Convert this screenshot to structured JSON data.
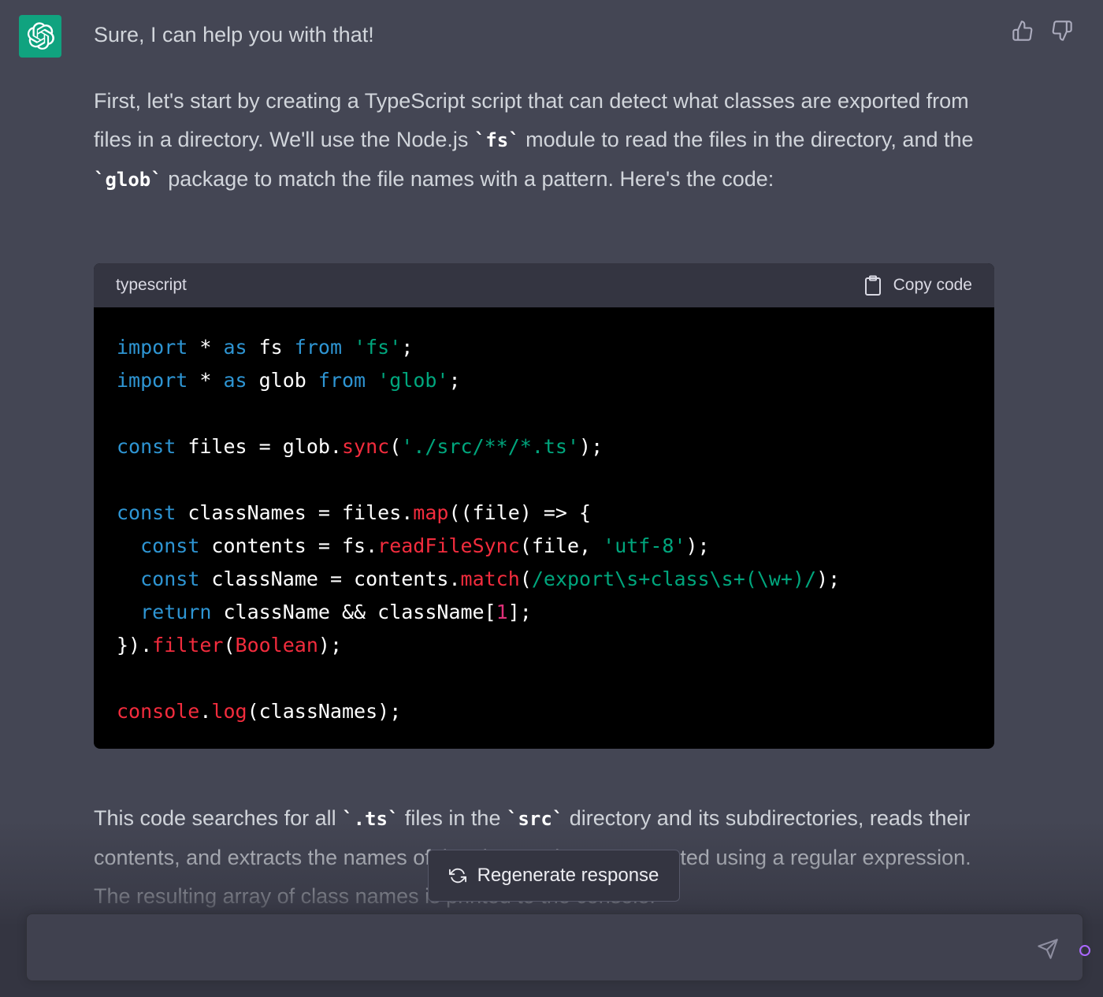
{
  "message": {
    "greeting": "Sure, I can help you with that!",
    "intro": [
      {
        "t": "First, let's start by creating a TypeScript script that can detect what classes are exported from files in a directory. We'll use the Node.js "
      },
      {
        "c": "`fs`"
      },
      {
        "t": " module to read the files in the directory, and the "
      },
      {
        "c": "`glob`"
      },
      {
        "t": " package to match the file names with a pattern. Here's the code:"
      }
    ],
    "explanation": [
      {
        "t": "This code searches for all "
      },
      {
        "c": "`.ts`"
      },
      {
        "t": " files in the "
      },
      {
        "c": "`src`"
      },
      {
        "t": " directory and its subdirectories, reads their contents, and extracts the names of the classes that are exported using a regular expression. The resulting array of class names is printed to the console."
      }
    ]
  },
  "code_block": {
    "language": "typescript",
    "copy_label": "Copy code",
    "lines": [
      [
        [
          "kw",
          "import"
        ],
        [
          "p",
          " * "
        ],
        [
          "kw",
          "as"
        ],
        [
          "p",
          " fs "
        ],
        [
          "kw",
          "from"
        ],
        [
          "p",
          " "
        ],
        [
          "str",
          "'fs'"
        ],
        [
          "p",
          ";"
        ]
      ],
      [
        [
          "kw",
          "import"
        ],
        [
          "p",
          " * "
        ],
        [
          "kw",
          "as"
        ],
        [
          "p",
          " glob "
        ],
        [
          "kw",
          "from"
        ],
        [
          "p",
          " "
        ],
        [
          "str",
          "'glob'"
        ],
        [
          "p",
          ";"
        ]
      ],
      [],
      [
        [
          "kw",
          "const"
        ],
        [
          "p",
          " files = glob."
        ],
        [
          "fn",
          "sync"
        ],
        [
          "p",
          "("
        ],
        [
          "str",
          "'./src/**/*.ts'"
        ],
        [
          "p",
          ");"
        ]
      ],
      [],
      [
        [
          "kw",
          "const"
        ],
        [
          "p",
          " classNames = files."
        ],
        [
          "fn",
          "map"
        ],
        [
          "p",
          "((file) => {"
        ]
      ],
      [
        [
          "p",
          "  "
        ],
        [
          "kw",
          "const"
        ],
        [
          "p",
          " contents = fs."
        ],
        [
          "fn",
          "readFileSync"
        ],
        [
          "p",
          "(file, "
        ],
        [
          "str",
          "'utf-8'"
        ],
        [
          "p",
          ");"
        ]
      ],
      [
        [
          "p",
          "  "
        ],
        [
          "kw",
          "const"
        ],
        [
          "p",
          " className = contents."
        ],
        [
          "fn",
          "match"
        ],
        [
          "p",
          "("
        ],
        [
          "str",
          "/export\\s+class\\s+(\\w+)/"
        ],
        [
          "p",
          ");"
        ]
      ],
      [
        [
          "p",
          "  "
        ],
        [
          "kw",
          "return"
        ],
        [
          "p",
          " className && className["
        ],
        [
          "num",
          "1"
        ],
        [
          "p",
          "];"
        ]
      ],
      [
        [
          "p",
          "})."
        ],
        [
          "fn",
          "filter"
        ],
        [
          "p",
          "("
        ],
        [
          "fn",
          "Boolean"
        ],
        [
          "p",
          ");"
        ]
      ],
      [],
      [
        [
          "obj",
          "console"
        ],
        [
          "p",
          "."
        ],
        [
          "fn",
          "log"
        ],
        [
          "p",
          "(classNames);"
        ]
      ]
    ]
  },
  "regenerate_label": "Regenerate response",
  "composer": {
    "placeholder": "",
    "value": ""
  },
  "icons": {
    "avatar": "openai-logo-icon",
    "thumbs_up": "thumbs-up-icon",
    "thumbs_down": "thumbs-down-icon",
    "copy": "clipboard-icon",
    "regenerate": "refresh-icon",
    "send": "send-icon"
  },
  "colors": {
    "background": "#444654",
    "avatar": "#10a37f",
    "keyword": "#2e95d3",
    "string": "#00a67d",
    "function": "#f22c3d",
    "number": "#df3079"
  }
}
